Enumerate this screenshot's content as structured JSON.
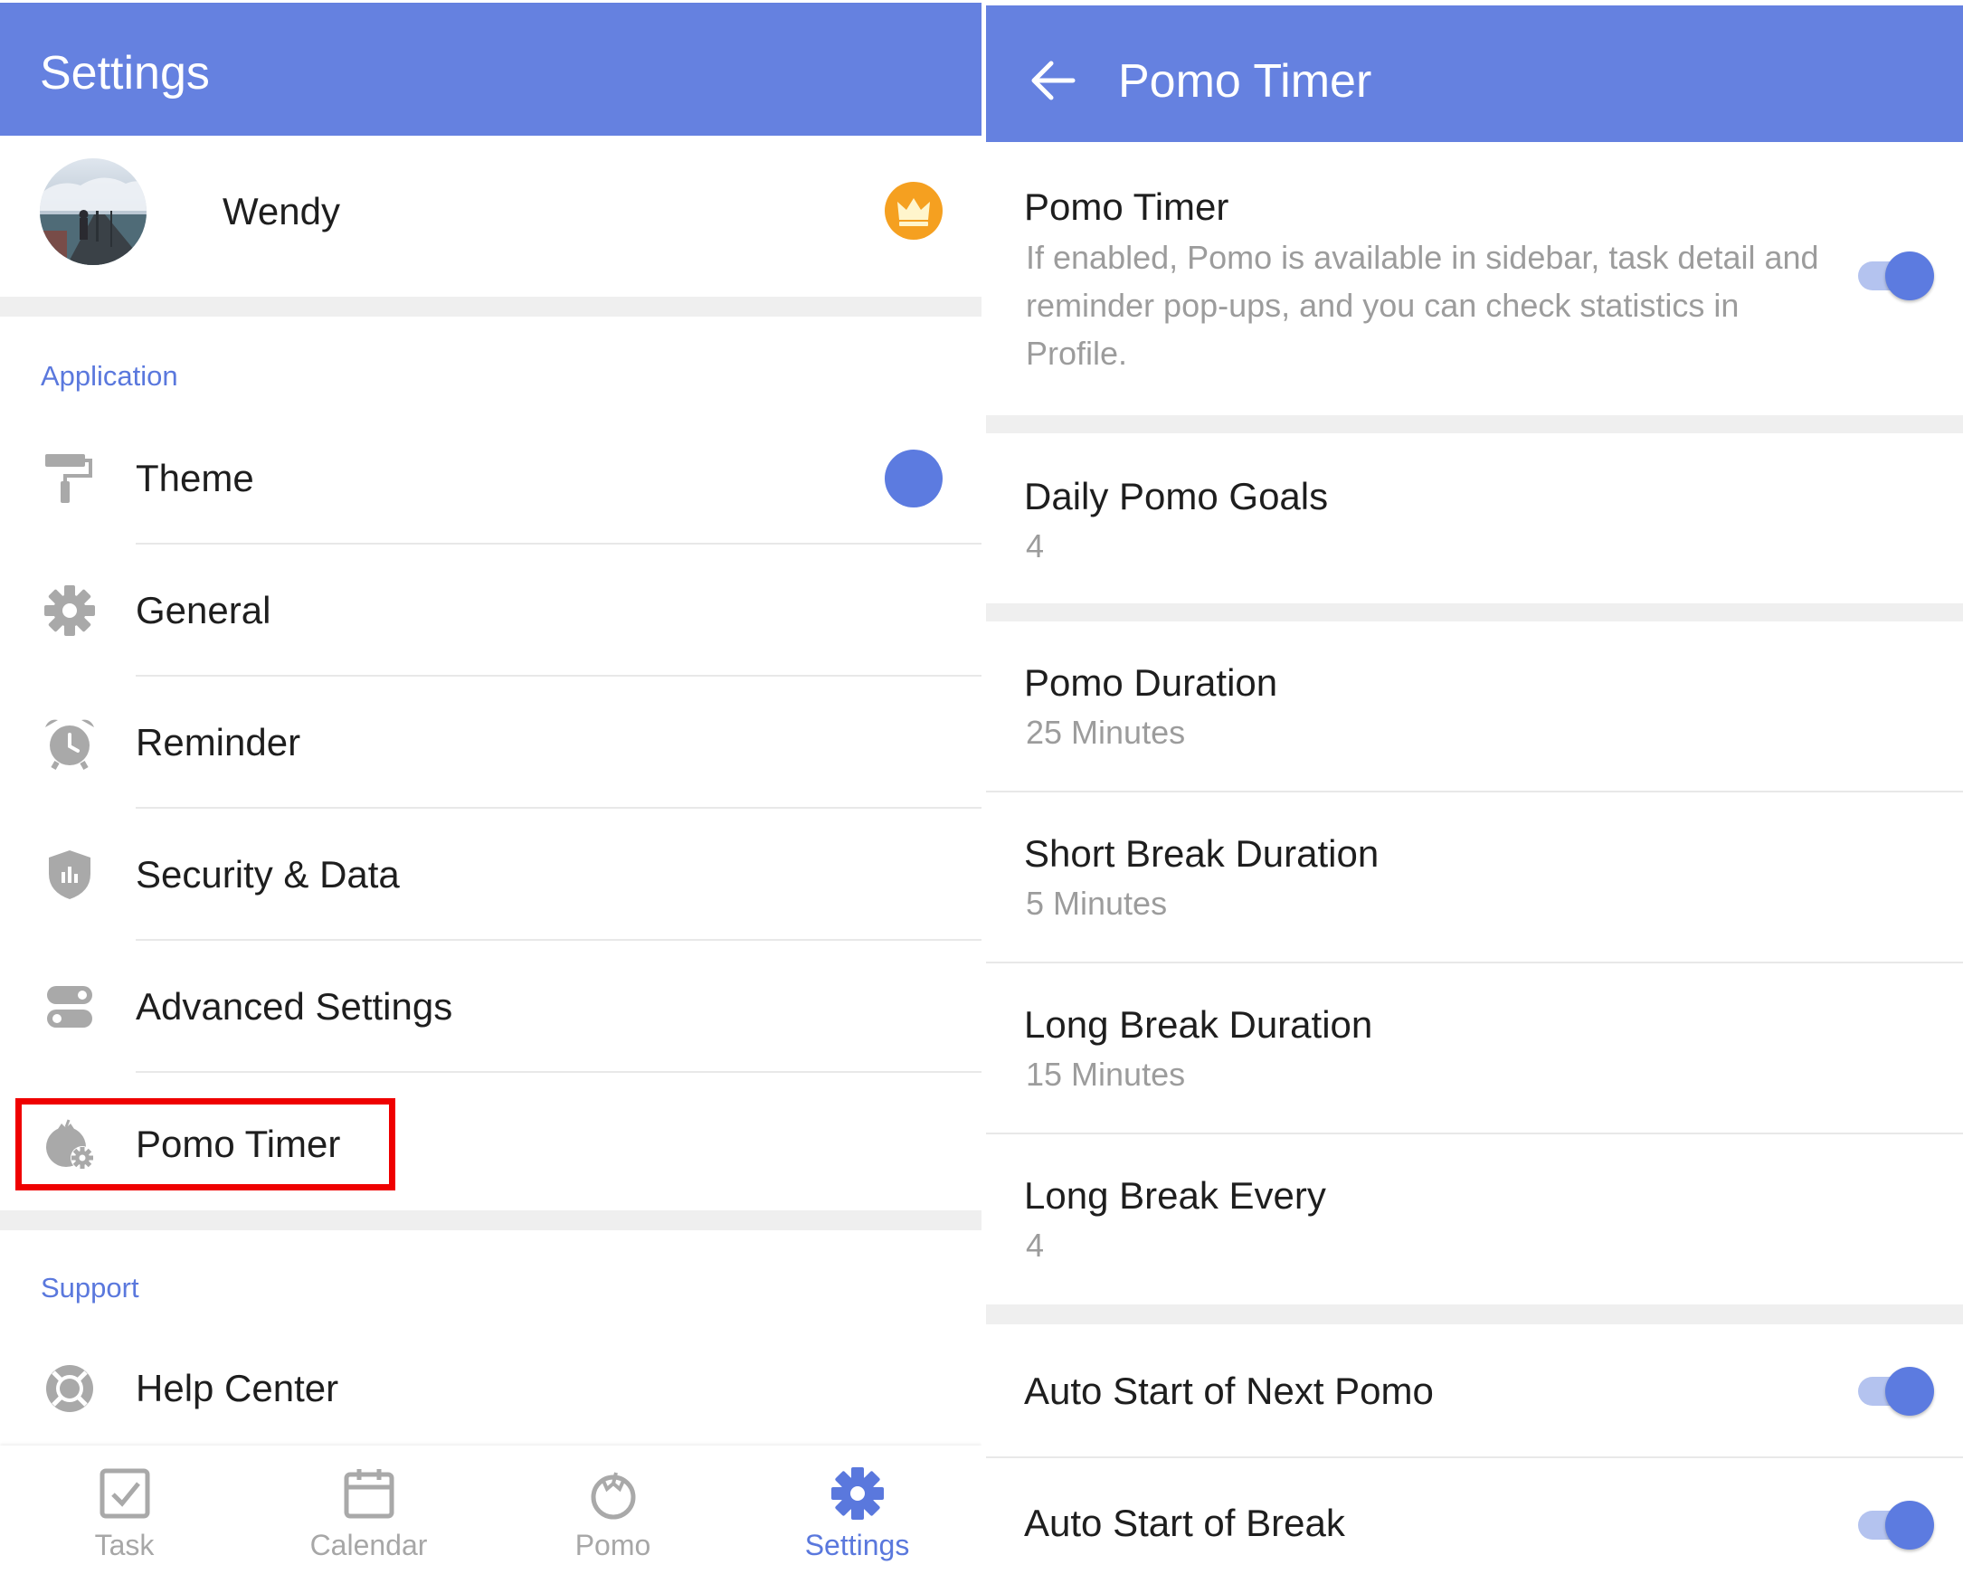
{
  "colors": {
    "primary": "#6581e0",
    "accent": "#5c7be0",
    "highlight": "#ef0000",
    "crown": "#f5a020",
    "icon_gray": "#a9a9a9"
  },
  "left": {
    "appbar": {
      "title": "Settings"
    },
    "profile": {
      "name": "Wendy",
      "avatar_icon": "avatar-photo",
      "badge_icon": "crown-icon"
    },
    "sections": {
      "application": "Application",
      "support": "Support"
    },
    "items": [
      {
        "label": "Theme",
        "icon": "paint-roller-icon"
      },
      {
        "label": "General",
        "icon": "gear-icon"
      },
      {
        "label": "Reminder",
        "icon": "alarm-clock-icon"
      },
      {
        "label": "Security & Data",
        "icon": "shield-icon"
      },
      {
        "label": "Advanced Settings",
        "icon": "toggles-icon"
      },
      {
        "label": "Pomo Timer",
        "icon": "pomo-settings-icon"
      }
    ],
    "support_items": [
      {
        "label": "Help Center",
        "icon": "lifebuoy-icon"
      }
    ],
    "bottom_nav": [
      {
        "label": "Task",
        "icon": "checkbox-icon",
        "active": false
      },
      {
        "label": "Calendar",
        "icon": "calendar-icon",
        "active": false
      },
      {
        "label": "Pomo",
        "icon": "tomato-icon",
        "active": false
      },
      {
        "label": "Settings",
        "icon": "gear-icon",
        "active": true
      }
    ]
  },
  "right": {
    "appbar": {
      "title": "Pomo Timer",
      "back_icon": "arrow-left-icon"
    },
    "pomo_timer": {
      "title": "Pomo Timer",
      "description": "If enabled, Pomo is available in sidebar, task detail and reminder pop-ups, and you can check statistics in Profile.",
      "enabled": true
    },
    "daily_goals": {
      "title": "Daily Pomo Goals",
      "value": "4"
    },
    "durations": [
      {
        "title": "Pomo Duration",
        "value": "25 Minutes"
      },
      {
        "title": "Short Break Duration",
        "value": "5 Minutes"
      },
      {
        "title": "Long Break Duration",
        "value": "15 Minutes"
      },
      {
        "title": "Long Break Every",
        "value": "4"
      }
    ],
    "auto_start": [
      {
        "title": "Auto Start of Next Pomo",
        "enabled": true
      },
      {
        "title": "Auto Start of Break",
        "enabled": true
      }
    ]
  }
}
